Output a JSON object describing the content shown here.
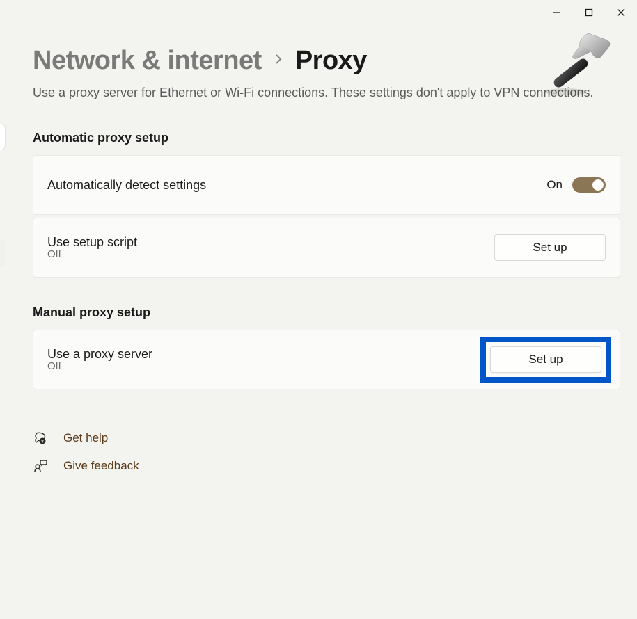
{
  "breadcrumb": {
    "parent": "Network & internet",
    "current": "Proxy"
  },
  "description": "Use a proxy server for Ethernet or Wi-Fi connections. These settings don't apply to VPN connections.",
  "sections": {
    "automatic": {
      "title": "Automatic proxy setup",
      "detect": {
        "label": "Automatically detect settings",
        "state": "On"
      },
      "script": {
        "label": "Use setup script",
        "status": "Off",
        "button": "Set up"
      }
    },
    "manual": {
      "title": "Manual proxy setup",
      "proxy": {
        "label": "Use a proxy server",
        "status": "Off",
        "button": "Set up"
      }
    }
  },
  "help": {
    "get_help": "Get help",
    "feedback": "Give feedback"
  }
}
